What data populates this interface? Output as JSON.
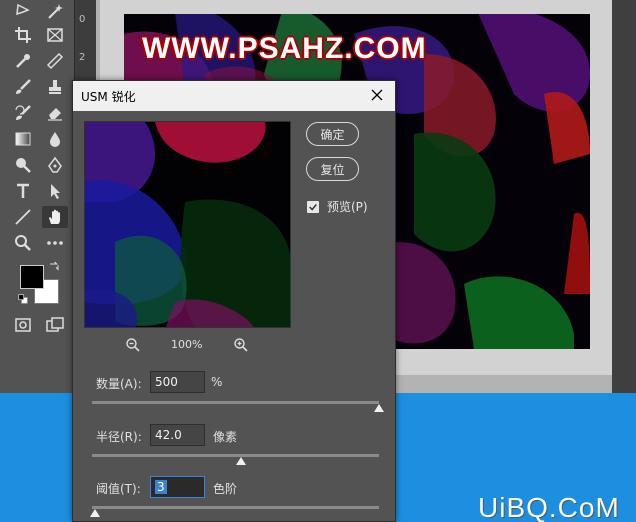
{
  "ruler": {
    "marks": [
      "0",
      "2"
    ]
  },
  "watermarks": {
    "top": "WWW.PSAHZ.COM",
    "bottom": "UiBQ.CoM"
  },
  "dialog": {
    "title": "USM 锐化",
    "ok_label": "确定",
    "reset_label": "复位",
    "preview_label": "预览(P)",
    "preview_checked": true,
    "zoom": "100%",
    "amount": {
      "label": "数量(A):",
      "value": "500",
      "unit": "%",
      "slider_fraction": 1.0
    },
    "radius": {
      "label": "半径(R):",
      "value": "42.0",
      "unit": "像素",
      "slider_fraction": 0.52
    },
    "threshold": {
      "label": "阈值(T):",
      "value": "3",
      "unit": "色阶",
      "slider_fraction": 0.01
    }
  },
  "colors": {
    "foreground": "#000000",
    "background": "#ffffff",
    "accent": "#3d82d6"
  }
}
